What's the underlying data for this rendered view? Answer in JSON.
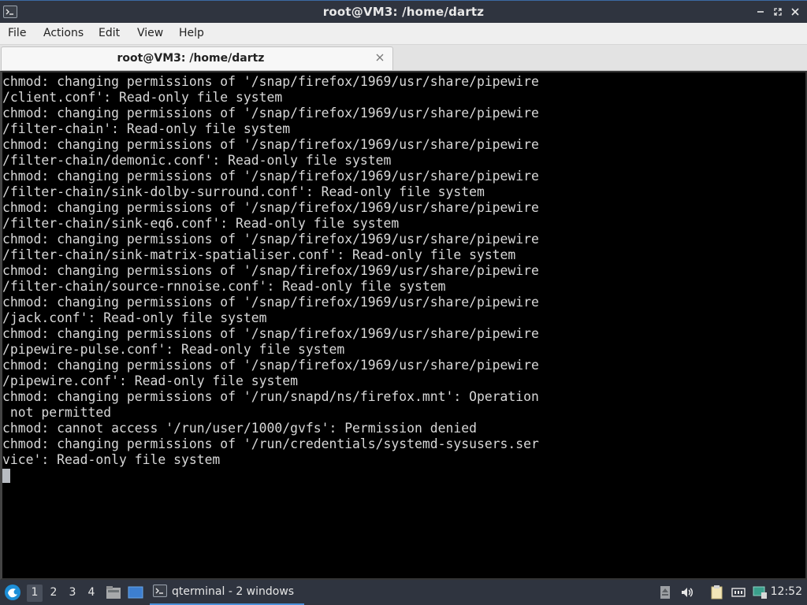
{
  "window": {
    "title": "root@VM3: /home/dartz",
    "app_icon": "terminal-icon",
    "controls": [
      "minimize-icon",
      "maximize-icon",
      "close-icon"
    ]
  },
  "menu": {
    "items": [
      "File",
      "Actions",
      "Edit",
      "View",
      "Help"
    ]
  },
  "tabs": [
    {
      "label": "root@VM3: /home/dartz",
      "close_icon": "close-icon"
    }
  ],
  "terminal": {
    "lines": [
      "chmod: changing permissions of '/snap/firefox/1969/usr/share/pipewire",
      "/client.conf': Read-only file system",
      "chmod: changing permissions of '/snap/firefox/1969/usr/share/pipewire",
      "/filter-chain': Read-only file system",
      "chmod: changing permissions of '/snap/firefox/1969/usr/share/pipewire",
      "/filter-chain/demonic.conf': Read-only file system",
      "chmod: changing permissions of '/snap/firefox/1969/usr/share/pipewire",
      "/filter-chain/sink-dolby-surround.conf': Read-only file system",
      "chmod: changing permissions of '/snap/firefox/1969/usr/share/pipewire",
      "/filter-chain/sink-eq6.conf': Read-only file system",
      "chmod: changing permissions of '/snap/firefox/1969/usr/share/pipewire",
      "/filter-chain/sink-matrix-spatialiser.conf': Read-only file system",
      "chmod: changing permissions of '/snap/firefox/1969/usr/share/pipewire",
      "/filter-chain/source-rnnoise.conf': Read-only file system",
      "chmod: changing permissions of '/snap/firefox/1969/usr/share/pipewire",
      "/jack.conf': Read-only file system",
      "chmod: changing permissions of '/snap/firefox/1969/usr/share/pipewire",
      "/pipewire-pulse.conf': Read-only file system",
      "chmod: changing permissions of '/snap/firefox/1969/usr/share/pipewire",
      "/pipewire.conf': Read-only file system",
      "chmod: changing permissions of '/run/snapd/ns/firefox.mnt': Operation",
      " not permitted",
      "chmod: cannot access '/run/user/1000/gvfs': Permission denied",
      "chmod: changing permissions of '/run/credentials/systemd-sysusers.ser",
      "vice': Read-only file system"
    ]
  },
  "taskbar": {
    "start_icon": "lxqt-start-icon",
    "workspaces": [
      "1",
      "2",
      "3",
      "4"
    ],
    "active_workspace": "1",
    "quicklaunch": [
      "file-manager-icon",
      "show-desktop-icon"
    ],
    "task": {
      "label": "qterminal - 2 windows",
      "icon": "terminal-icon"
    },
    "tray": [
      "eject-icon",
      "volume-icon",
      "clipboard-icon",
      "network-icon",
      "screen-icon"
    ],
    "clock": "12:52"
  }
}
